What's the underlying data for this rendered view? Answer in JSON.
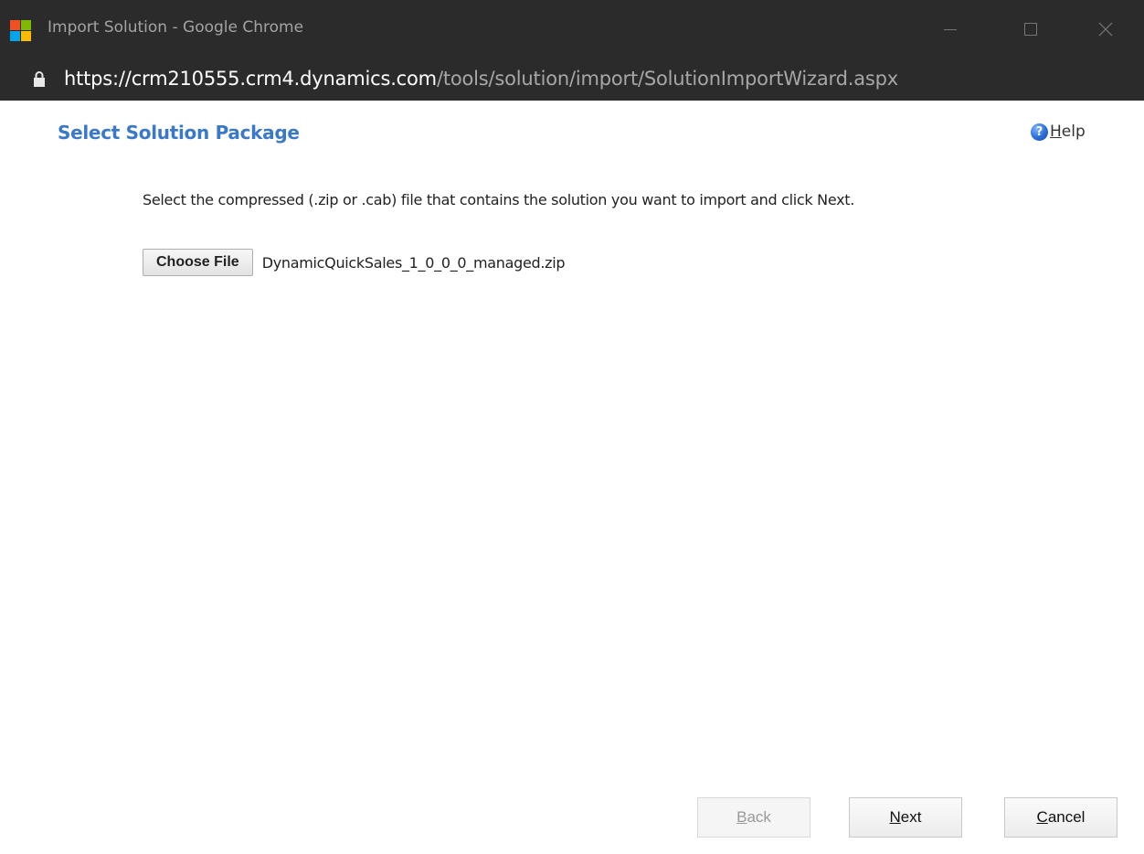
{
  "window": {
    "title": "Import Solution - Google Chrome",
    "logo": "microsoft-logo",
    "logo_colors": [
      "#f25022",
      "#7fba00",
      "#00a4ef",
      "#ffb900"
    ]
  },
  "address_bar": {
    "scheme": "https://",
    "host": "crm210555.crm4.dynamics.com",
    "path": "/tools/solution/import/SolutionImportWizard.aspx",
    "secure_icon": "lock-icon"
  },
  "page": {
    "title": "Select Solution Package",
    "help_label_accel": "H",
    "help_label_rest": "elp",
    "help_icon": "question-icon",
    "instructions": "Select the compressed (.zip or .cab) file that contains the solution you want to import and click Next.",
    "choose_file_label": "Choose File",
    "file_name": "DynamicQuickSales_1_0_0_0_managed.zip"
  },
  "footer": {
    "back": {
      "accel": "B",
      "rest": "ack",
      "enabled": false
    },
    "next": {
      "accel": "N",
      "rest": "ext",
      "enabled": true
    },
    "cancel": {
      "accel": "C",
      "rest": "ancel",
      "enabled": true
    }
  },
  "colors": {
    "chrome_bg": "#2b2b2b",
    "title_blue": "#3a78c9"
  }
}
